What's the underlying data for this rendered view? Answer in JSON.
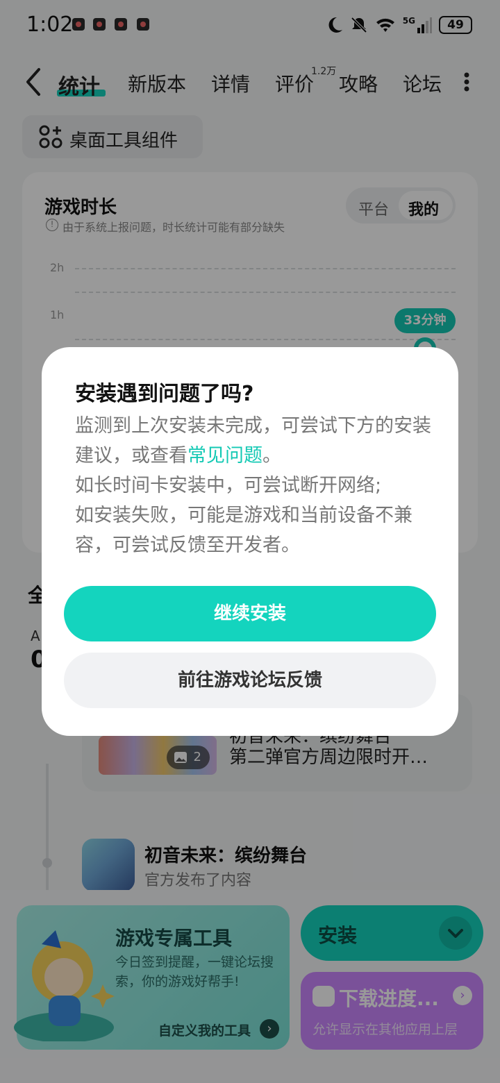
{
  "status_bar": {
    "time": "1:02",
    "battery": "49",
    "network": "5G"
  },
  "nav": {
    "tabs": [
      {
        "label": "统计"
      },
      {
        "label": "新版本"
      },
      {
        "label": "详情"
      },
      {
        "label": "评价",
        "badge": "1.2万"
      },
      {
        "label": "攻略"
      },
      {
        "label": "论坛"
      }
    ]
  },
  "widget_button": {
    "label": "桌面工具组件"
  },
  "stats_card": {
    "title": "游戏时长",
    "note": "由于系统上报问题，时长统计可能有部分缺失",
    "toggle": {
      "options": [
        "平台",
        "我的"
      ],
      "selected": "我的"
    },
    "y_ticks": [
      "2h",
      "1h"
    ],
    "value_label": "33分钟"
  },
  "background_section": {
    "heading": "全",
    "label": "A",
    "value": "0"
  },
  "post": {
    "line1": "初音未来：缤纷舞台",
    "line2": "第二弹官方周边限时开…",
    "image_count": "2"
  },
  "activity": {
    "game_name": "初音未来：缤纷舞台",
    "subtitle": "官方发布了内容"
  },
  "bottom": {
    "tools": {
      "title": "游戏专属工具",
      "desc": "今日签到提醒，一键论坛搜索，你的游戏好帮手!",
      "link": "自定义我的工具"
    },
    "install": {
      "label": "安装"
    },
    "progress": {
      "title": "下载进度...",
      "desc": "允许显示在其他应用上层"
    }
  },
  "dialog": {
    "title": "安装遇到问题了吗?",
    "body_before_link": "监测到上次安装未完成，可尝试下方的安装建议，或查看",
    "link": "常见问题",
    "body_after_link": "。",
    "line2": "如长时间卡安装中，可尝试断开网络;",
    "line3": "如安装失败，可能是游戏和当前设备不兼容，可尝试反馈至开发者。",
    "primary_button": "继续安装",
    "secondary_button": "前往游戏论坛反馈"
  },
  "colors": {
    "accent": "#14d4be",
    "purple": "#cc88ff",
    "overlay": "rgba(0,0,0,0.40)"
  }
}
